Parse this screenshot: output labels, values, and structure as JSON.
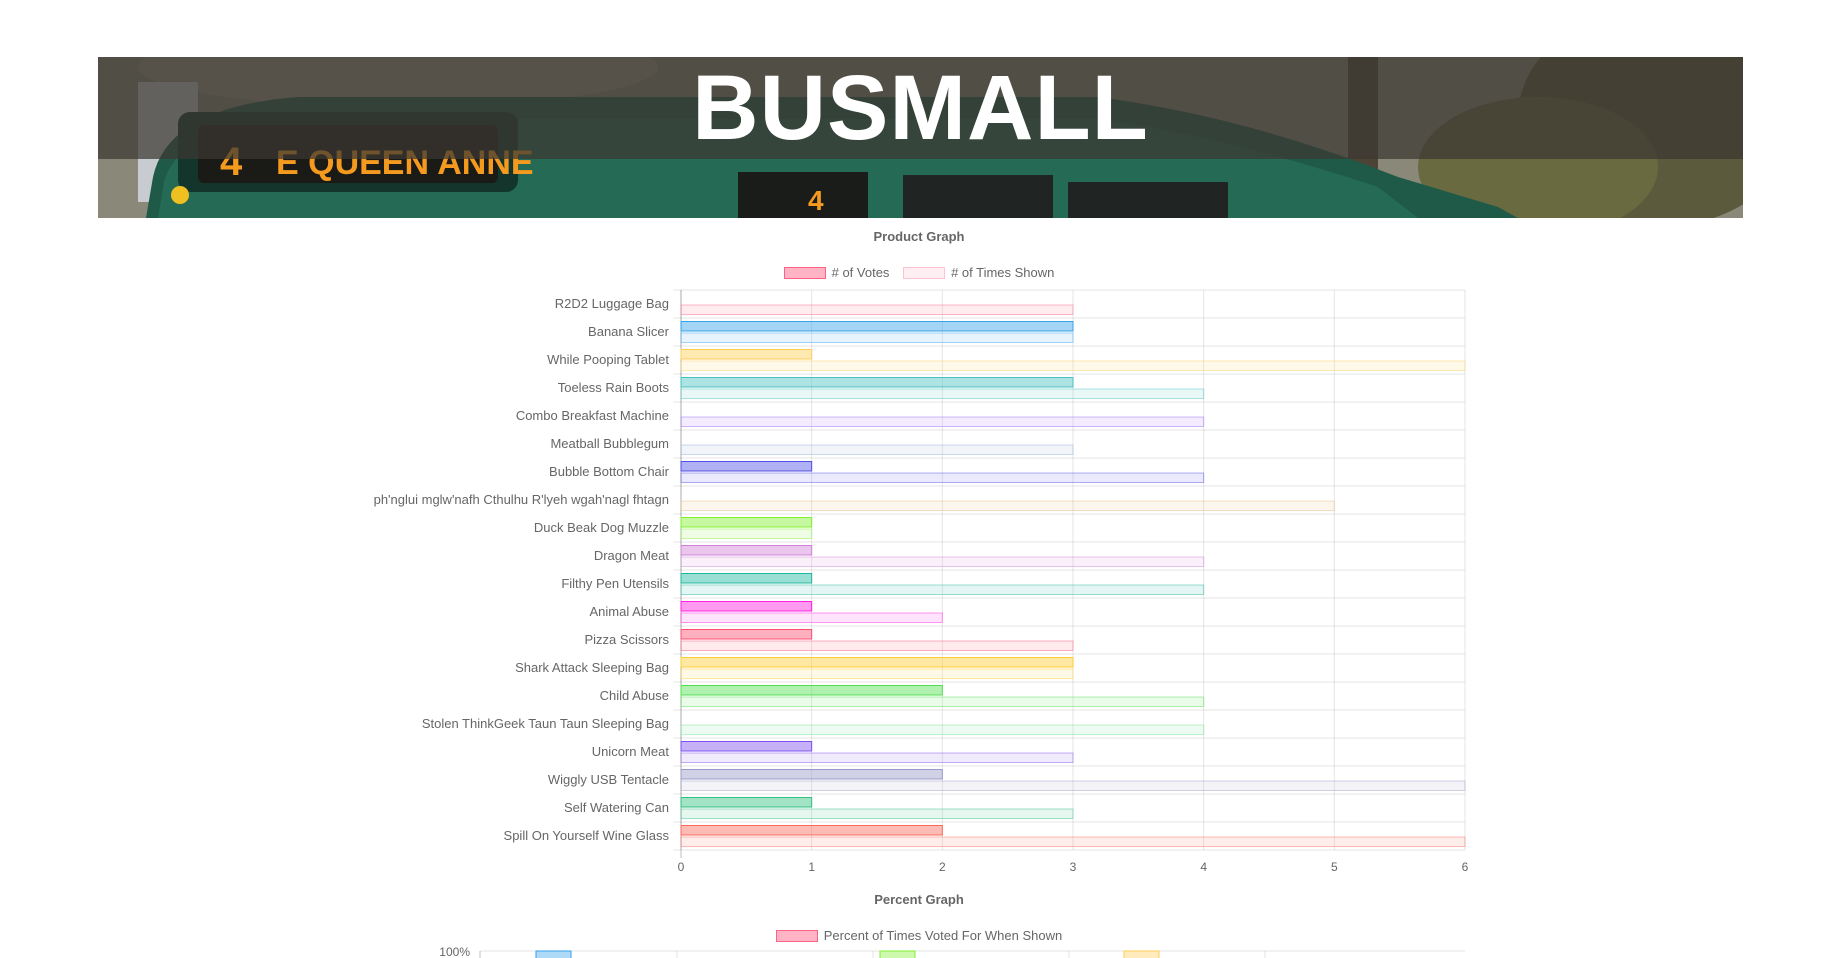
{
  "banner": {
    "title": "BUSMALL",
    "sign_route": "4",
    "sign_destination": "E QUEEN ANNE",
    "window_route": "4"
  },
  "chart_data": [
    {
      "type": "bar",
      "orientation": "horizontal",
      "title": "Product Graph",
      "categories": [
        "R2D2 Luggage Bag",
        "Banana Slicer",
        "While Pooping Tablet",
        "Toeless Rain Boots",
        "Combo Breakfast Machine",
        "Meatball Bubblegum",
        "Bubble Bottom Chair",
        "ph'nglui mglw'nafh Cthulhu R'lyeh wgah'nagl fhtagn",
        "Duck Beak Dog Muzzle",
        "Dragon Meat",
        "Filthy Pen Utensils",
        "Animal Abuse",
        "Pizza Scissors",
        "Shark Attack Sleeping Bag",
        "Child Abuse",
        "Stolen ThinkGeek Taun Taun Sleeping Bag",
        "Unicorn Meat",
        "Wiggly USB Tentacle",
        "Self Watering Can",
        "Spill On Yourself Wine Glass"
      ],
      "series": [
        {
          "name": "# of Votes",
          "values": [
            0,
            3,
            1,
            3,
            0,
            0,
            1,
            0,
            1,
            1,
            1,
            1,
            1,
            3,
            2,
            0,
            1,
            2,
            1,
            2
          ]
        },
        {
          "name": "# of Times Shown",
          "values": [
            3,
            3,
            6,
            4,
            4,
            3,
            4,
            5,
            1,
            4,
            4,
            2,
            3,
            3,
            4,
            4,
            3,
            6,
            3,
            6
          ]
        }
      ],
      "bar_colors": [
        "#ff6384",
        "#36a2eb",
        "#ffce56",
        "#4bc0c0",
        "#9966ff",
        "#8faad6",
        "#5050e6",
        "#e6b87a",
        "#80f030",
        "#d080d8",
        "#20b8a0",
        "#ff20e0",
        "#ff5070",
        "#ffcc33",
        "#50e050",
        "#70e090",
        "#8050f0",
        "#9a9ac8",
        "#30c080",
        "#f86a5a"
      ],
      "legend_swatches": {
        "votes_fill": "#ffb3c4",
        "votes_border": "#ff6384",
        "shown_fill": "#ffeef2",
        "shown_border": "#ffc2d1"
      },
      "xlim": [
        0,
        6
      ],
      "x_ticks": [
        "0",
        "1",
        "2",
        "3",
        "4",
        "5",
        "6"
      ],
      "grid": true,
      "legend_position": "top"
    },
    {
      "type": "bar",
      "title": "Percent Graph",
      "series": [
        {
          "name": "Percent of Times Voted For When Shown"
        }
      ],
      "legend_swatch": {
        "fill": "#ffb3c4",
        "border": "#ff6384"
      },
      "y_top_tick": "100%",
      "visible_bar_colors": [
        "#36a2eb",
        "#80f030",
        "#ffce56"
      ],
      "grid": true,
      "legend_position": "top"
    }
  ]
}
